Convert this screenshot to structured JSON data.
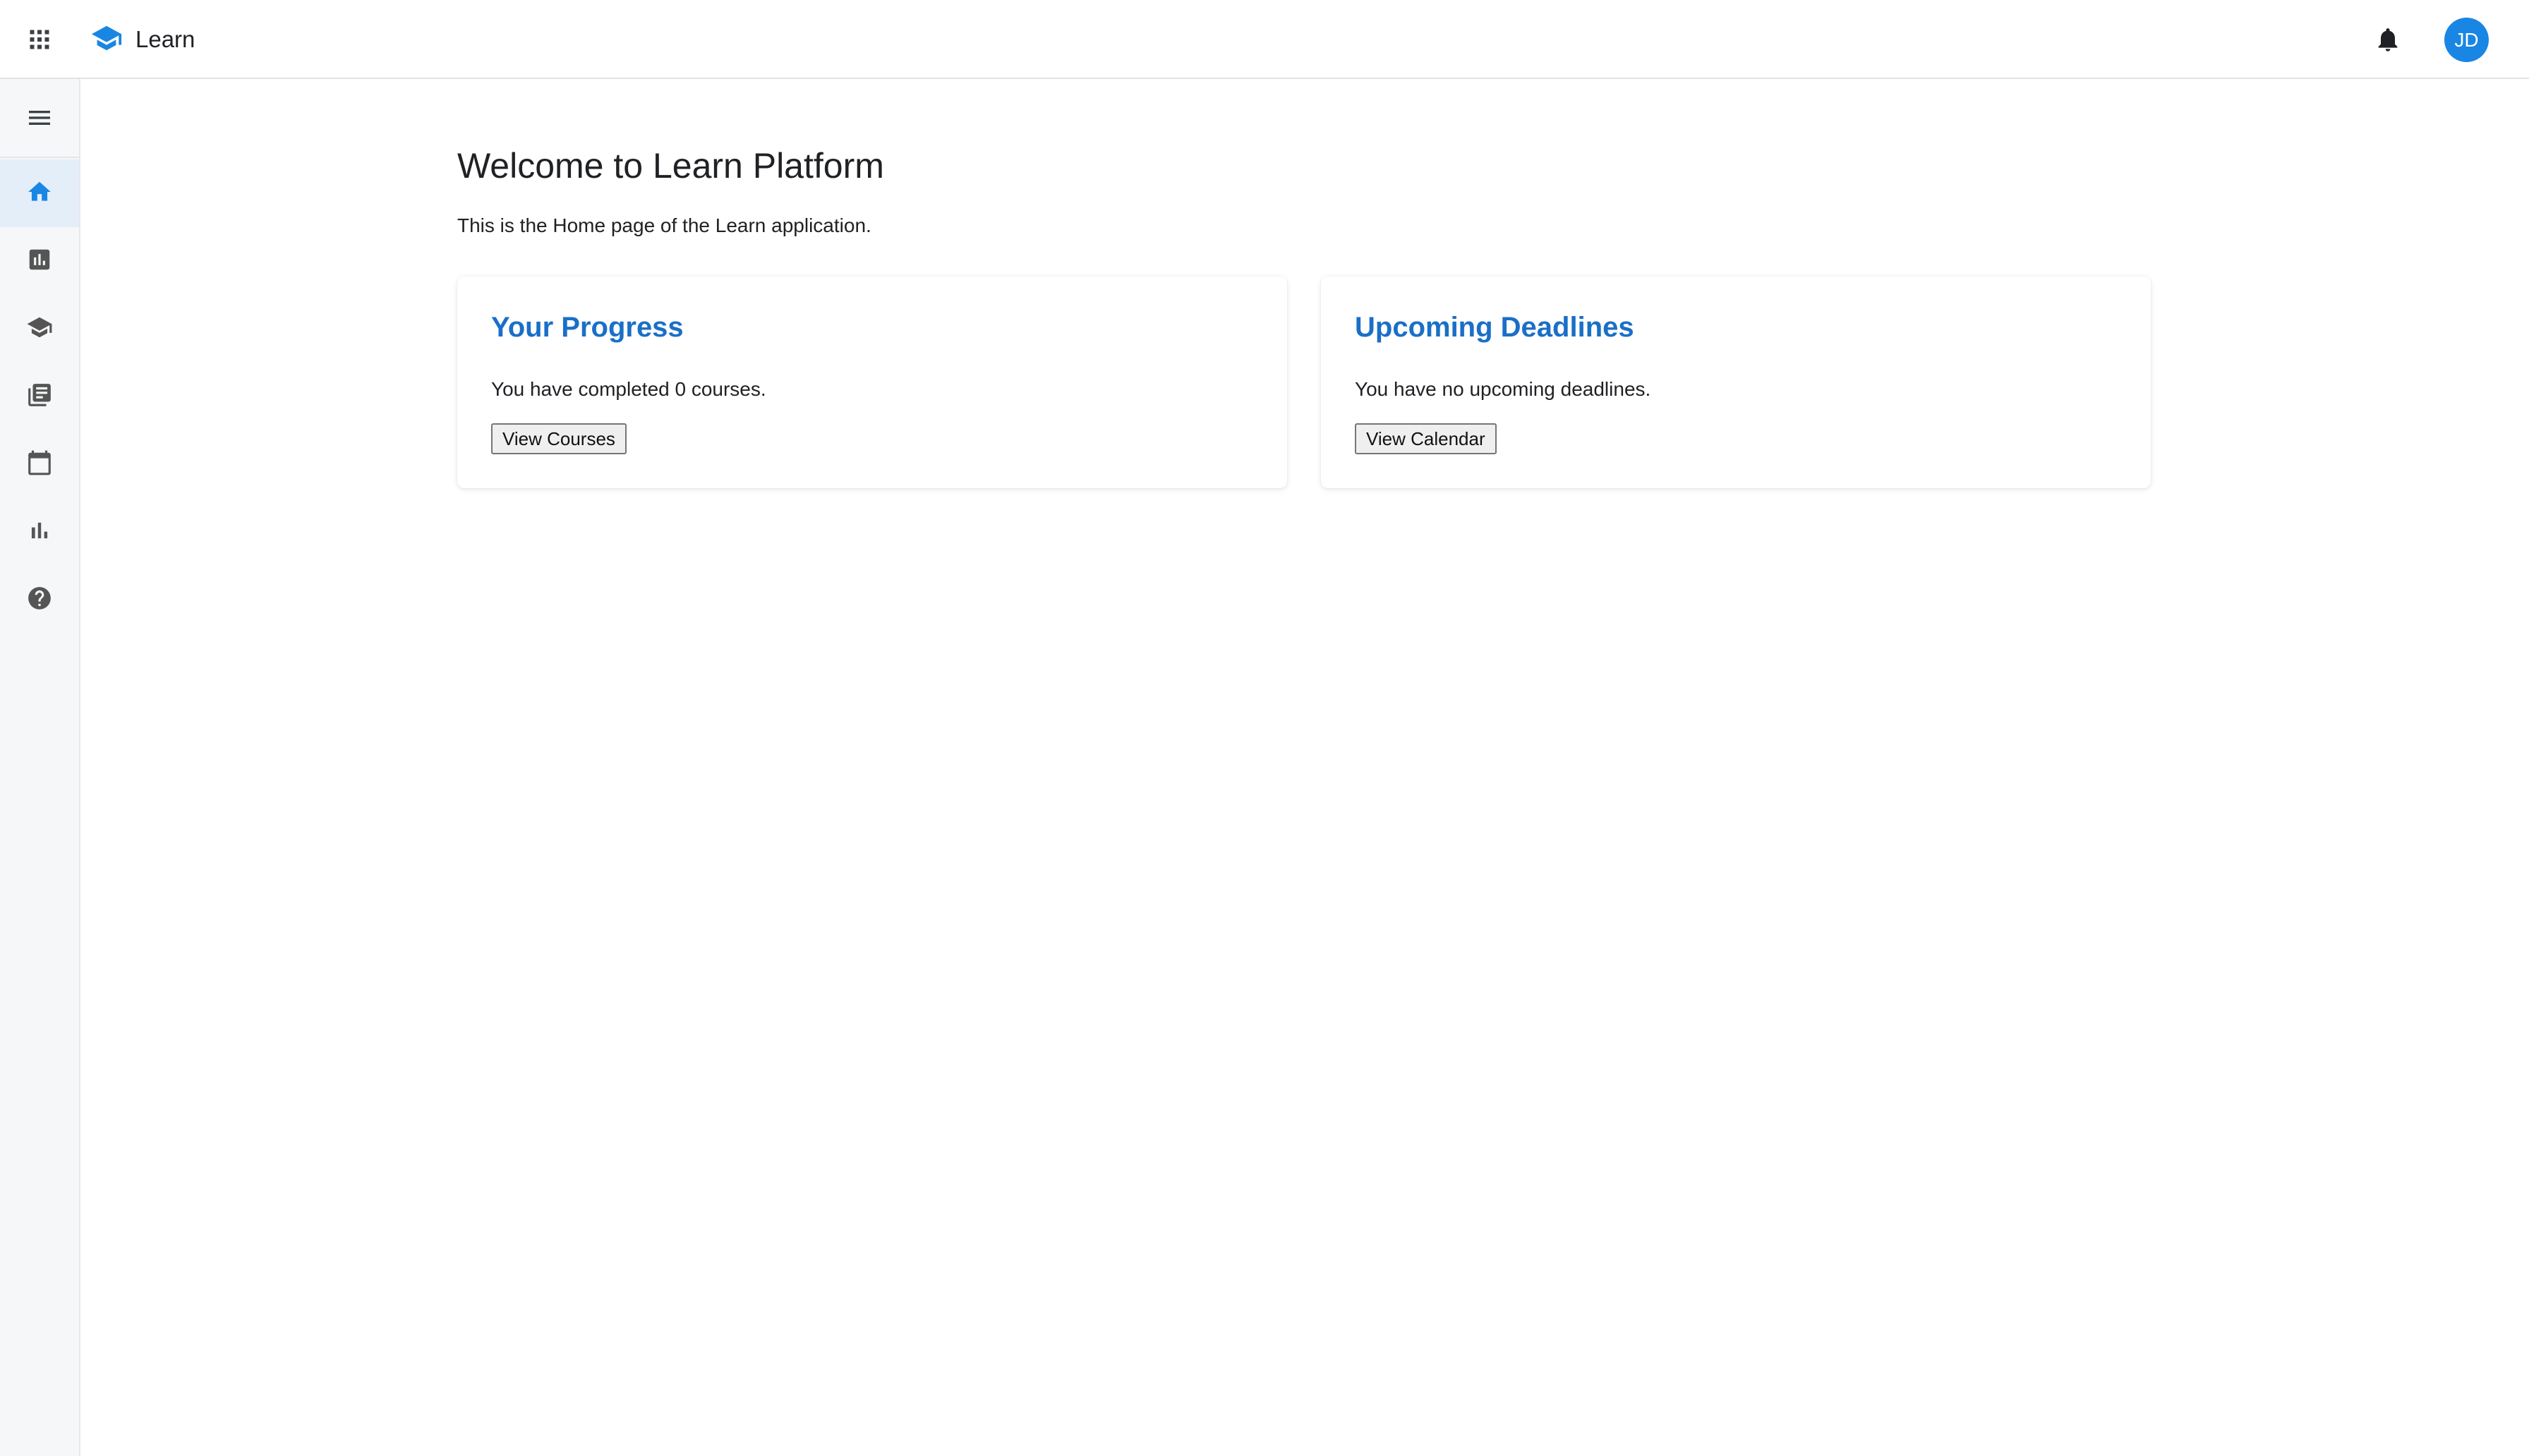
{
  "header": {
    "app_title": "Learn",
    "avatar_initials": "JD",
    "icons": [
      "apps-grid-icon",
      "graduation-cap-icon",
      "bell-icon"
    ]
  },
  "sidebar": {
    "menu_icon": "hamburger-menu-icon",
    "items": [
      {
        "name": "home",
        "icon": "home-icon",
        "active": true
      },
      {
        "name": "dashboard",
        "icon": "bar-chart-box-icon",
        "active": false
      },
      {
        "name": "courses",
        "icon": "graduation-cap-icon",
        "active": false
      },
      {
        "name": "library",
        "icon": "library-books-icon",
        "active": false
      },
      {
        "name": "calendar",
        "icon": "calendar-icon",
        "active": false
      },
      {
        "name": "reports",
        "icon": "bar-chart-icon",
        "active": false
      },
      {
        "name": "help",
        "icon": "help-circle-icon",
        "active": false
      }
    ]
  },
  "main": {
    "title": "Welcome to Learn Platform",
    "subtitle": "This is the Home page of the Learn application.",
    "cards": [
      {
        "title": "Your Progress",
        "text": "You have completed 0 courses.",
        "button_label": "View Courses"
      },
      {
        "title": "Upcoming Deadlines",
        "text": "You have no upcoming deadlines.",
        "button_label": "View Calendar"
      }
    ]
  },
  "colors": {
    "accent": "#1a6fc7",
    "avatar_bg": "#1a86e4",
    "sidebar_bg": "#f5f7f9",
    "active_nav_bg": "#e3eef9",
    "icon_gray": "#555555"
  }
}
